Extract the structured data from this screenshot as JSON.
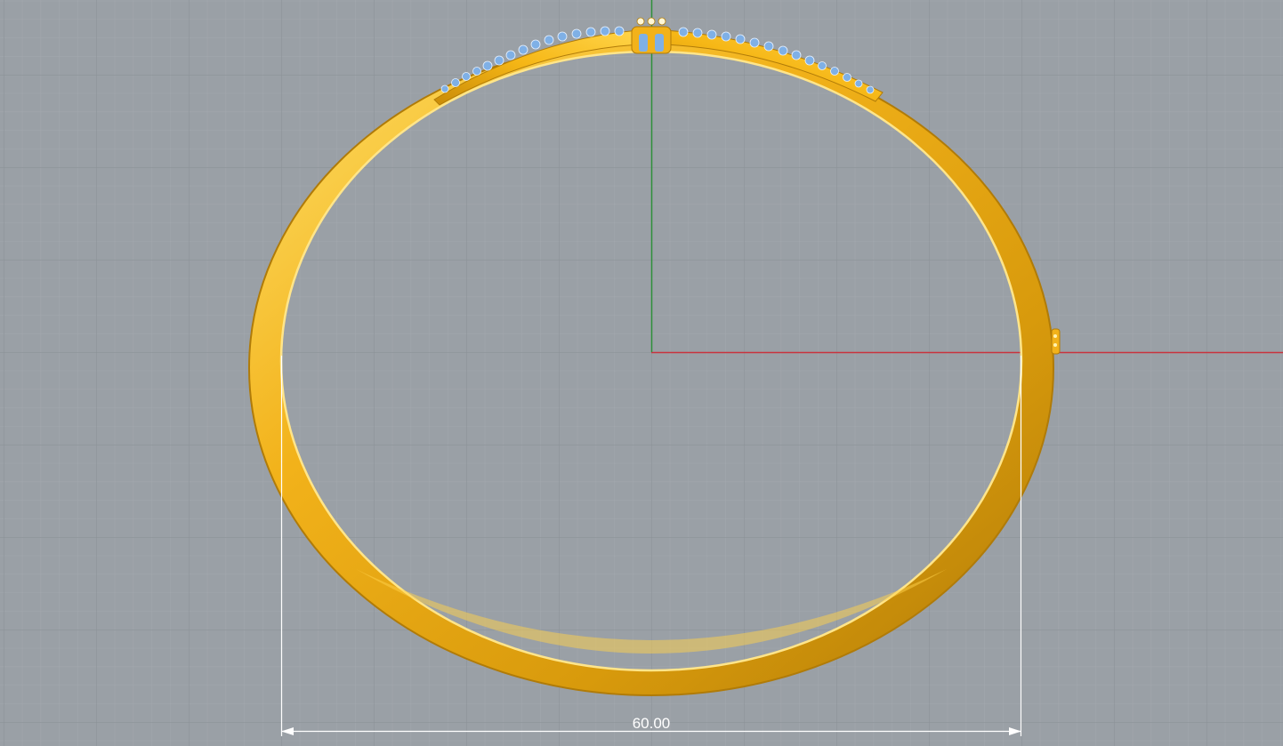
{
  "viewport": {
    "background_color": "#9aa0a6",
    "grid_minor_color": "#a3a8ae",
    "grid_major_color": "#8c9298",
    "x_axis_color": "#c8333d",
    "y_axis_color": "#2e8f3a"
  },
  "model": {
    "gold_color": "#f2b21a",
    "gold_highlight": "#ffe16a",
    "gold_shadow": "#b07b08",
    "stone_color": "#7fb0e6"
  },
  "dimension": {
    "value_label": "60.00",
    "line_color": "#ffffff"
  },
  "icons": [
    "world-axes-icon",
    "dimension-arrow-icon"
  ]
}
